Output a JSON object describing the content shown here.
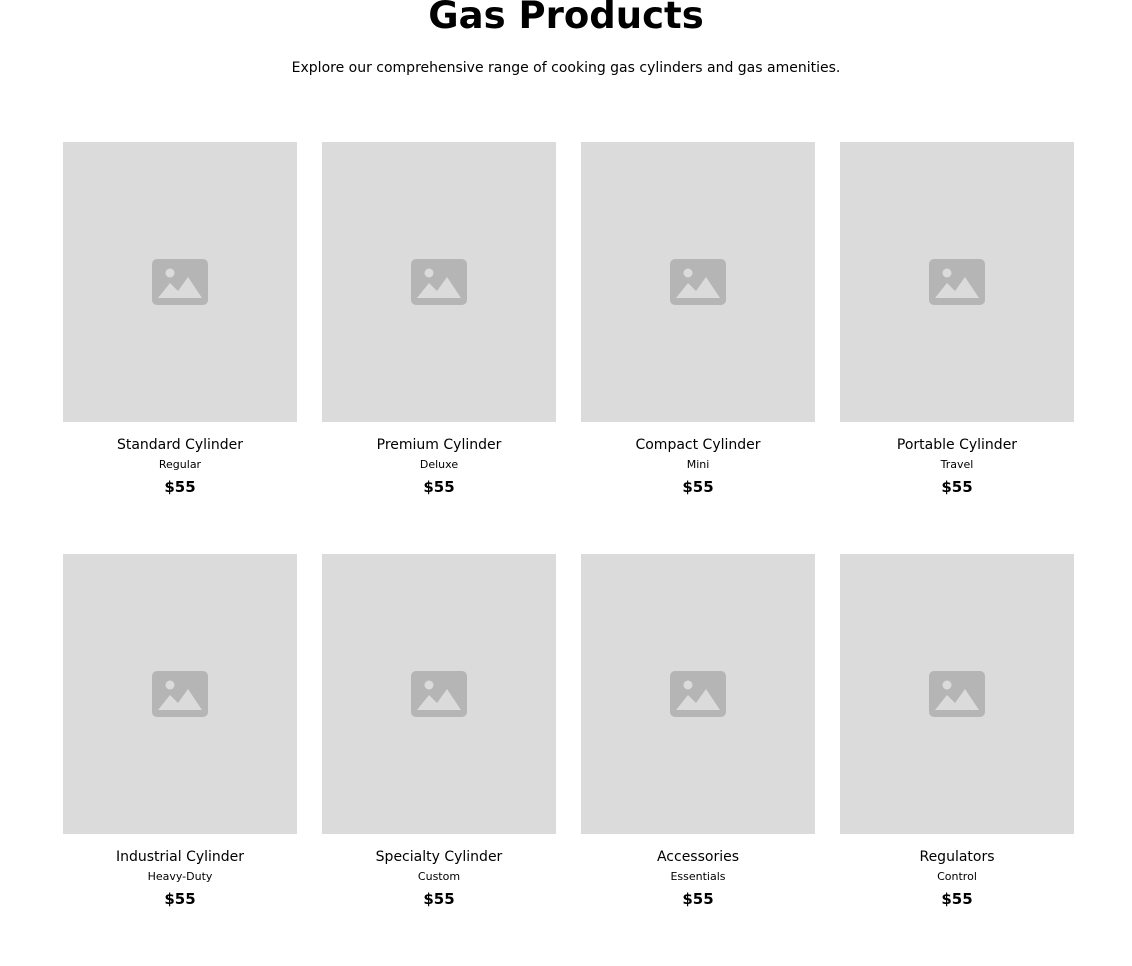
{
  "header": {
    "title": "Gas Products",
    "subtitle": "Explore our comprehensive range of cooking gas cylinders and gas amenities."
  },
  "colors": {
    "placeholder_background": "#dbdbdb",
    "placeholder_icon": "#b5b5b5"
  },
  "products": [
    {
      "name": "Standard Cylinder",
      "variant": "Regular",
      "price": "$55",
      "image_icon": "image-placeholder-icon"
    },
    {
      "name": "Premium Cylinder",
      "variant": "Deluxe",
      "price": "$55",
      "image_icon": "image-placeholder-icon"
    },
    {
      "name": "Compact Cylinder",
      "variant": "Mini",
      "price": "$55",
      "image_icon": "image-placeholder-icon"
    },
    {
      "name": "Portable Cylinder",
      "variant": "Travel",
      "price": "$55",
      "image_icon": "image-placeholder-icon"
    },
    {
      "name": "Industrial Cylinder",
      "variant": "Heavy-Duty",
      "price": "$55",
      "image_icon": "image-placeholder-icon"
    },
    {
      "name": "Specialty Cylinder",
      "variant": "Custom",
      "price": "$55",
      "image_icon": "image-placeholder-icon"
    },
    {
      "name": "Accessories",
      "variant": "Essentials",
      "price": "$55",
      "image_icon": "image-placeholder-icon"
    },
    {
      "name": "Regulators",
      "variant": "Control",
      "price": "$55",
      "image_icon": "image-placeholder-icon"
    }
  ]
}
